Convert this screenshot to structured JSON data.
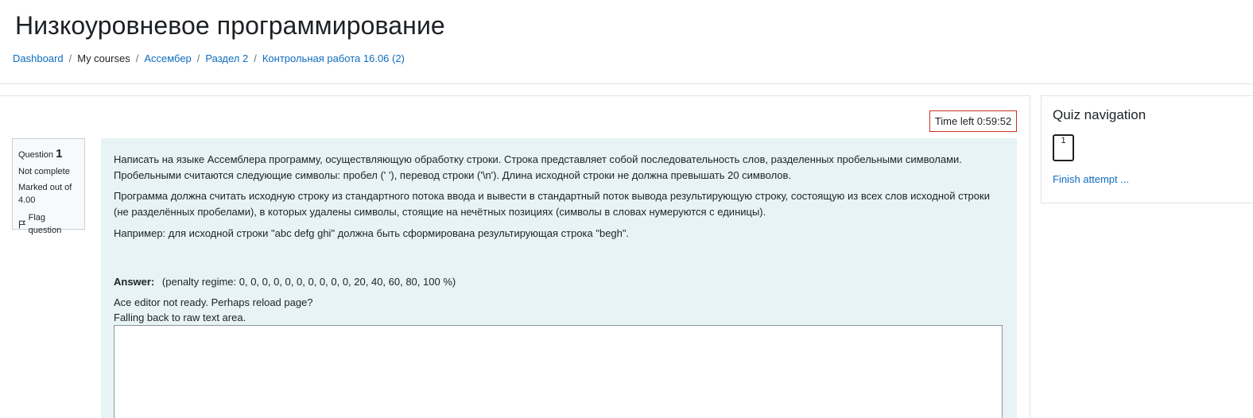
{
  "page_title": "Низкоуровневое программирование",
  "breadcrumb": {
    "items": [
      {
        "label": "Dashboard",
        "link": true
      },
      {
        "label": "My courses",
        "link": false
      },
      {
        "label": "Ассембер",
        "link": true
      },
      {
        "label": "Раздел 2",
        "link": true
      },
      {
        "label": "Контрольная работа 16.06 (2)",
        "link": true
      }
    ],
    "separator": "/"
  },
  "timer": {
    "label": "Time left",
    "value": "0:59:52"
  },
  "question_info": {
    "question_label": "Question",
    "number": "1",
    "status": "Not complete",
    "marked_out_of": "Marked out of 4.00",
    "flag_label": "Flag question",
    "flag_icon": "flag-icon"
  },
  "question": {
    "paragraphs": [
      "Написать на языке Ассемблера программу, осуществляющую обработку строки. Строка представляет собой последовательность слов, разделенных пробельными символами. Пробельными считаются следующие символы: пробел (' '), перевод строки ('\\n'). Длина исходной строки не должна превышать 20 символов.",
      "Программа должна считать исходную строку из стандартного потока ввода и вывести в стандартный поток вывода результирующую строку, состоящую из всех слов исходной строки (не разделённых пробелами), в которых удалены символы, стоящие на нечётных позициях (символы в словах нумеруются с единицы).",
      "Например: для исходной строки \"abc defg ghi\" должна быть сформирована результирующая строка \"begh\"."
    ],
    "answer_label": "Answer:",
    "penalty": "(penalty regime: 0, 0, 0, 0, 0, 0, 0, 0, 0, 0, 20, 40, 60, 80, 100 %)",
    "ace_not_ready": "Ace editor not ready. Perhaps reload page?",
    "fallback": "Falling back to raw text area.",
    "answer_value": ""
  },
  "quiz_navigation": {
    "title": "Quiz navigation",
    "buttons": [
      {
        "label": "1"
      }
    ],
    "finish_label": "Finish attempt ..."
  },
  "colors": {
    "link": "#0f6cbf",
    "timer_border": "#ca3120",
    "question_bg": "#e7f3f5",
    "info_bg": "#f8f9fa"
  }
}
